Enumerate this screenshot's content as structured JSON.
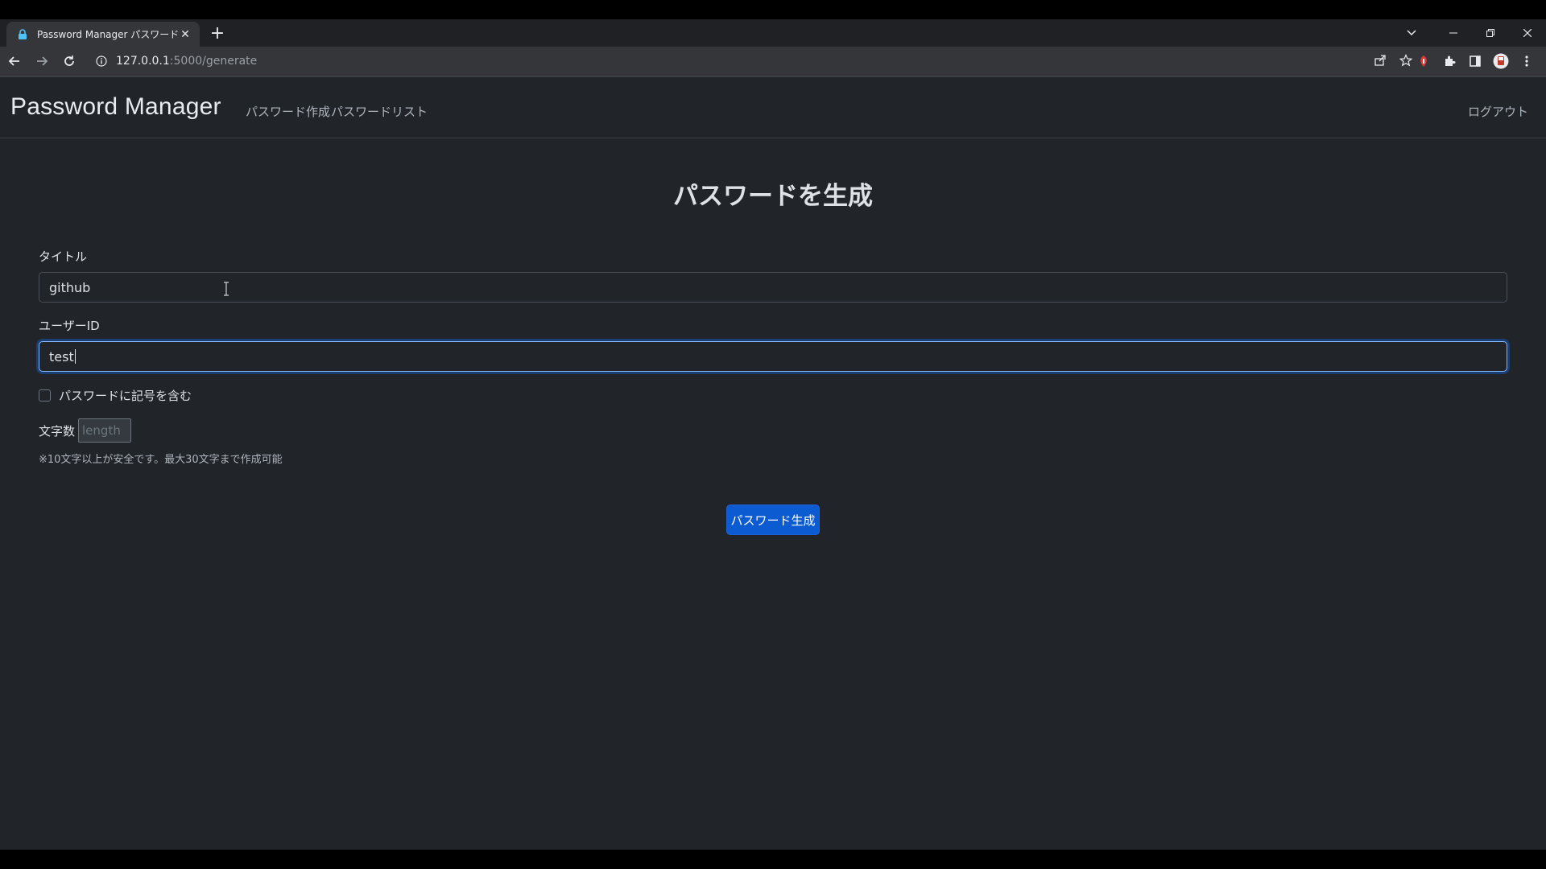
{
  "browser": {
    "tab_title": "Password Manager パスワード作成",
    "url_host": "127.0.0.1",
    "url_path": ":5000/generate"
  },
  "navbar": {
    "brand": "Password Manager",
    "links": {
      "generate": "パスワード作成",
      "list": "パスワードリスト",
      "logout": "ログアウト"
    }
  },
  "form": {
    "heading": "パスワードを生成",
    "title_label": "タイトル",
    "title_value": "github",
    "userid_label": "ユーザーID",
    "userid_value": "test",
    "symbols_label": "パスワードに記号を含む",
    "symbols_checked": false,
    "length_label": "文字数",
    "length_placeholder": "length",
    "hint": "※10文字以上が安全です。最大30文字まで作成可能",
    "submit_label": "パスワード生成"
  },
  "colors": {
    "page_bg": "#212529",
    "primary_button": "#0d5bd1",
    "focus_ring": "#86b7fe"
  }
}
